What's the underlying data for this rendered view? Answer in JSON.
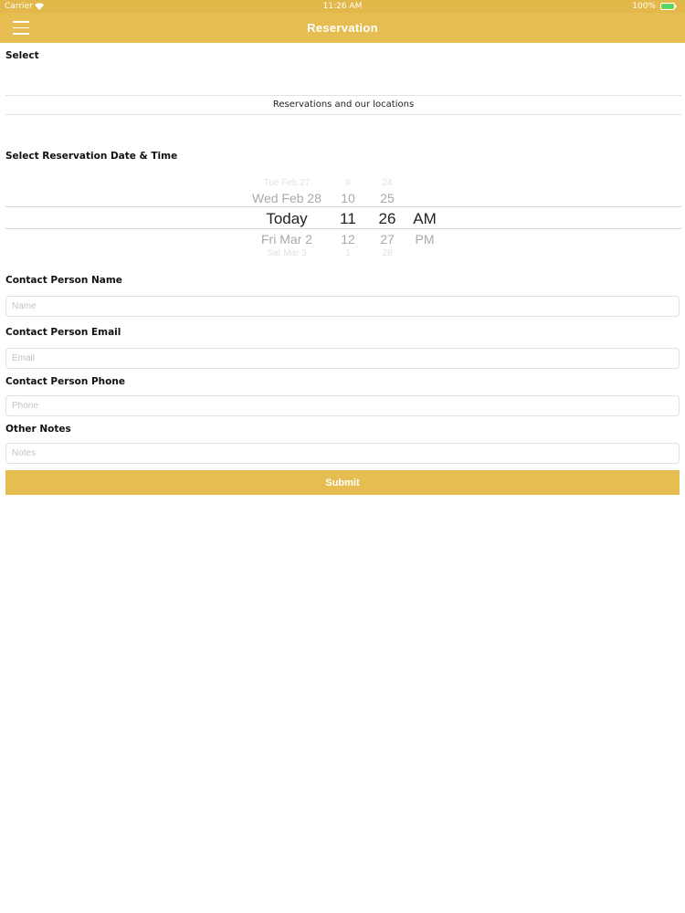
{
  "status_bar": {
    "carrier": "Carrier",
    "time": "11:26 AM",
    "battery": "100%"
  },
  "nav": {
    "title": "Reservation",
    "menu_icon": "hamburger-menu-icon"
  },
  "select_section": {
    "label": "Select",
    "location_text": "Reservations and our locations"
  },
  "datetime_section": {
    "label": "Select Reservation Date & Time",
    "picker": {
      "day": {
        "above_far": "Tue Feb 27",
        "above": "Wed Feb 28",
        "selected": "Today",
        "below": "Fri Mar 2",
        "below_far": "Sat Mar 3"
      },
      "hour": {
        "above_far": "9",
        "above": "10",
        "selected": "11",
        "below": "12",
        "below_far": "1"
      },
      "minute": {
        "above_far": "24",
        "above": "25",
        "selected": "26",
        "below": "27",
        "below_far": "28"
      },
      "ampm": {
        "selected": "AM",
        "other": "PM"
      }
    }
  },
  "contact_name": {
    "label": "Contact Person Name",
    "placeholder": "Name",
    "value": ""
  },
  "contact_email": {
    "label": "Contact Person Email",
    "placeholder": "Email",
    "value": ""
  },
  "contact_phone": {
    "label": "Contact Person Phone",
    "placeholder": "Phone",
    "value": ""
  },
  "other_notes": {
    "label": "Other Notes",
    "placeholder": "Notes",
    "value": ""
  },
  "submit": {
    "label": "Submit"
  },
  "colors": {
    "accent": "#e5bd51",
    "status_bar": "#e3b84a",
    "battery_fill": "#4cd964"
  }
}
